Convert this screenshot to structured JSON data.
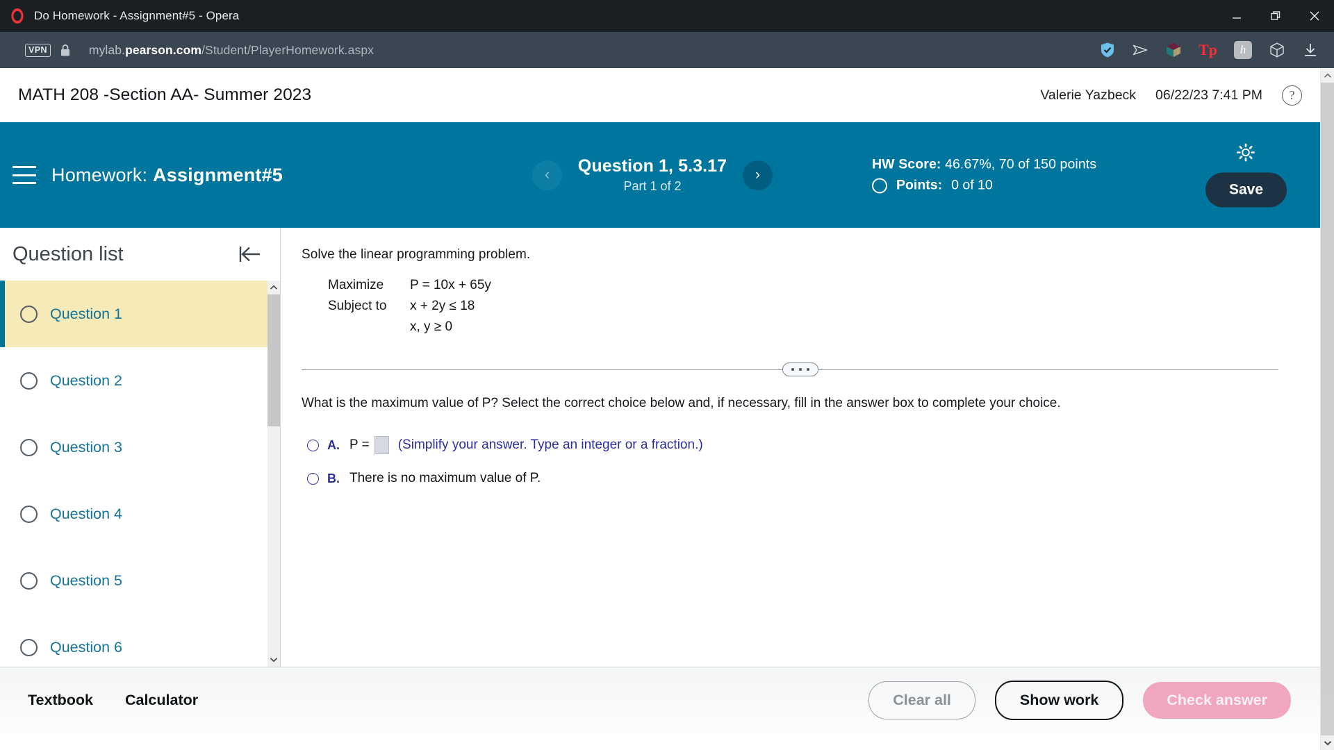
{
  "window": {
    "title": "Do Homework - Assignment#5 - Opera",
    "logo_icon": "opera-logo-icon",
    "minimize_icon": "minimize-icon",
    "restore_icon": "restore-icon",
    "close_icon": "close-icon"
  },
  "addressbar": {
    "vpn_badge": "VPN",
    "lock_icon": "lock-icon",
    "url_host_prefix": "mylab.",
    "url_host_bold": "pearson.com",
    "url_path": "/Student/PlayerHomework.aspx",
    "extensions": [
      {
        "name": "shield-check-icon"
      },
      {
        "name": "send-arrow-icon"
      },
      {
        "name": "cube-color-icon"
      },
      {
        "name": "tp-logo-icon",
        "label": "Tp"
      },
      {
        "name": "honey-extension-icon",
        "label": "h"
      },
      {
        "name": "cube-outline-icon"
      },
      {
        "name": "download-icon"
      }
    ]
  },
  "course_header": {
    "title": "MATH 208 -Section AA- Summer 2023",
    "user_name": "Valerie Yazbeck",
    "timestamp": "06/22/23 7:41 PM",
    "help_icon_label": "?"
  },
  "homework_bar": {
    "menu_icon": "hamburger-menu-icon",
    "label_prefix": "Homework:",
    "assignment_name": "Assignment#5",
    "prev_icon": "chevron-left-icon",
    "next_icon": "chevron-right-icon",
    "question_title": "Question 1, 5.3.17",
    "part_label": "Part 1 of 2",
    "hw_score_label": "HW Score:",
    "hw_score_value": "46.67%, 70 of 150 points",
    "points_label": "Points:",
    "points_value": "0 of 10",
    "settings_icon": "gear-icon",
    "save_label": "Save",
    "accent_color": "#00769e",
    "save_button_color": "#1d3344"
  },
  "question_list": {
    "title": "Question list",
    "collapse_icon": "collapse-panel-left-icon",
    "items": [
      {
        "label": "Question 1",
        "active": true
      },
      {
        "label": "Question 2",
        "active": false
      },
      {
        "label": "Question 3",
        "active": false
      },
      {
        "label": "Question 4",
        "active": false
      },
      {
        "label": "Question 5",
        "active": false
      },
      {
        "label": "Question 6",
        "active": false
      }
    ],
    "active_bg_color": "#f6eab8",
    "active_border_color": "#007396",
    "link_color": "#12749b"
  },
  "problem": {
    "prompt": "Solve the linear programming problem.",
    "math": {
      "line1_label": "Maximize",
      "line1_expr": "P = 10x + 65y",
      "line2_label": "Subject to",
      "line2_expr": "x + 2y  ≤  18",
      "line3_expr": "x, y  ≥  0"
    },
    "divider_handle_icon": "divider-dots-handle-icon",
    "question_text": "What is the maximum value of P? Select the correct choice below and, if necessary, fill in the answer box to complete your choice.",
    "choices": [
      {
        "letter": "A.",
        "prefix": "P =",
        "input_value": "",
        "hint": "(Simplify your answer. Type an integer or a fraction.)",
        "selected": false
      },
      {
        "letter": "B.",
        "text": "There is no maximum value of P.",
        "selected": false
      }
    ]
  },
  "bottom_bar": {
    "textbook_label": "Textbook",
    "calculator_label": "Calculator",
    "clear_all_label": "Clear all",
    "show_work_label": "Show work",
    "check_answer_label": "Check answer",
    "check_answer_color": "#f0a6bc"
  }
}
